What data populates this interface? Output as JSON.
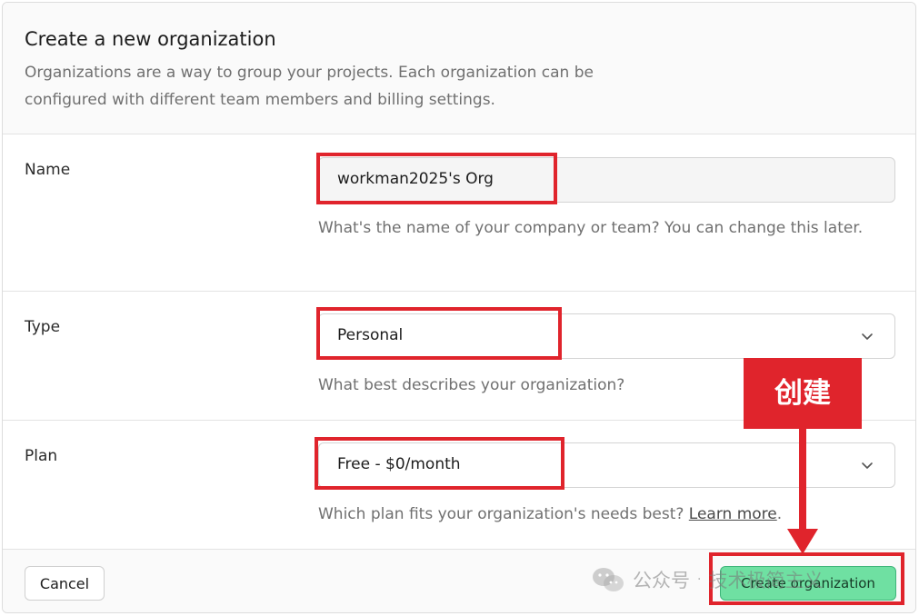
{
  "header": {
    "title": "Create a new organization",
    "description": "Organizations are a way to group your projects. Each organization can be configured with different team members and billing settings."
  },
  "fields": {
    "name": {
      "label": "Name",
      "value": "workman2025's Org",
      "help": "What's the name of your company or team? You can change this later."
    },
    "type": {
      "label": "Type",
      "value": "Personal",
      "help": "What best describes your organization?"
    },
    "plan": {
      "label": "Plan",
      "value": "Free - $0/month",
      "help_prefix": "Which plan fits your organization's needs best? ",
      "help_link": "Learn more",
      "help_suffix": "."
    }
  },
  "footer": {
    "cancel_label": "Cancel",
    "create_label": "Create organization"
  },
  "annotation": {
    "tag": "创建",
    "color": "#e0242c"
  },
  "watermark": {
    "source": "公众号",
    "separator": "·",
    "author": "技术极简主义"
  },
  "colors": {
    "accent_green": "#6fe0a2",
    "annotation_red": "#e0242c"
  }
}
